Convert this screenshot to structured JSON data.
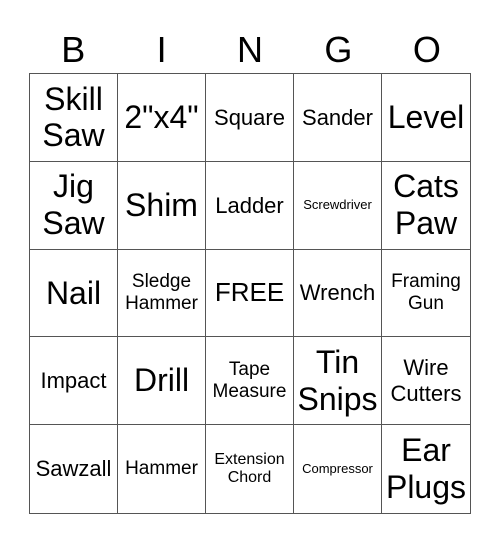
{
  "header": [
    "B",
    "I",
    "N",
    "G",
    "O"
  ],
  "cells": [
    {
      "text": "Skill Saw",
      "size": 32
    },
    {
      "text": "2\"x4\"",
      "size": 32
    },
    {
      "text": "Square",
      "size": 22
    },
    {
      "text": "Sander",
      "size": 22
    },
    {
      "text": "Level",
      "size": 32
    },
    {
      "text": "Jig Saw",
      "size": 32
    },
    {
      "text": "Shim",
      "size": 32
    },
    {
      "text": "Ladder",
      "size": 22
    },
    {
      "text": "Screwdriver",
      "size": 13
    },
    {
      "text": "Cats Paw",
      "size": 32
    },
    {
      "text": "Nail",
      "size": 32
    },
    {
      "text": "Sledge Hammer",
      "size": 19
    },
    {
      "text": "FREE",
      "size": 26
    },
    {
      "text": "Wrench",
      "size": 22
    },
    {
      "text": "Framing Gun",
      "size": 19
    },
    {
      "text": "Impact",
      "size": 22
    },
    {
      "text": "Drill",
      "size": 32
    },
    {
      "text": "Tape Measure",
      "size": 19
    },
    {
      "text": "Tin Snips",
      "size": 32
    },
    {
      "text": "Wire Cutters",
      "size": 22
    },
    {
      "text": "Sawzall",
      "size": 22
    },
    {
      "text": "Hammer",
      "size": 19
    },
    {
      "text": "Extension Chord",
      "size": 16
    },
    {
      "text": "Compressor",
      "size": 13
    },
    {
      "text": "Ear Plugs",
      "size": 32
    }
  ]
}
